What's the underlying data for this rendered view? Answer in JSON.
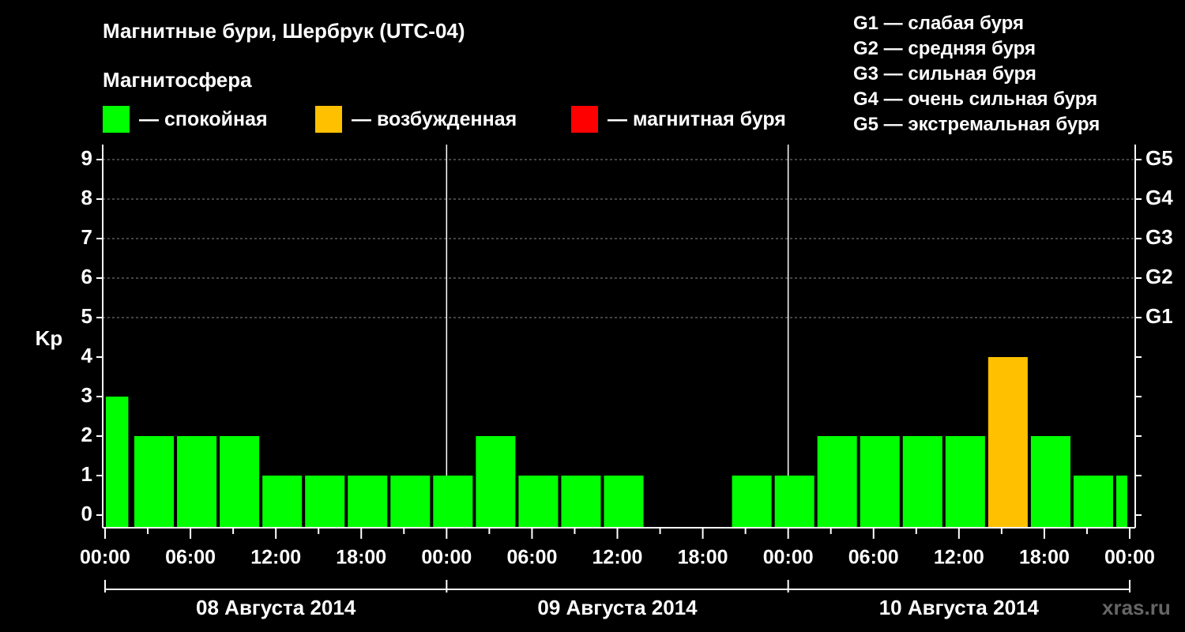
{
  "title": "Магнитные бури, Шербрук (UTC-04)",
  "subtitle": "Магнитосфера",
  "legend": [
    {
      "label": "— спокойная",
      "color": "#00ff00"
    },
    {
      "label": "— возбужденная",
      "color": "#ffc000"
    },
    {
      "label": "— магнитная буря",
      "color": "#ff0000"
    }
  ],
  "g_scale": [
    "G1 — слабая буря",
    "G2 — средняя буря",
    "G3 — сильная буря",
    "G4 — очень сильная буря",
    "G5 — экстремальная буря"
  ],
  "watermark": "xras.ru",
  "chart_data": {
    "type": "bar",
    "ylabel": "Kp",
    "ylim": [
      0,
      9
    ],
    "y_ticks": [
      "0",
      "1",
      "2",
      "3",
      "4",
      "5",
      "6",
      "7",
      "8",
      "9"
    ],
    "right_ticks": [
      {
        "value": 5,
        "label": "G1"
      },
      {
        "value": 6,
        "label": "G2"
      },
      {
        "value": 7,
        "label": "G3"
      },
      {
        "value": 8,
        "label": "G4"
      },
      {
        "value": 9,
        "label": "G5"
      }
    ],
    "x_range_hours": [
      0,
      72
    ],
    "x_tick_labels": [
      "00:00",
      "06:00",
      "12:00",
      "18:00",
      "00:00",
      "06:00",
      "12:00",
      "18:00",
      "00:00",
      "06:00",
      "12:00",
      "18:00",
      "00:00"
    ],
    "days": [
      "08 Августа 2014",
      "09 Августа 2014",
      "10 Августа 2014"
    ],
    "grid": "dashed horizontal at 5–9",
    "colors": {
      "quiet": "#00ff00",
      "active": "#ffc000",
      "storm": "#ff0000"
    },
    "bars": [
      {
        "start": 0,
        "end": 1.8,
        "kp": 3,
        "status": "quiet"
      },
      {
        "start": 2,
        "end": 5,
        "kp": 2,
        "status": "quiet"
      },
      {
        "start": 5,
        "end": 8,
        "kp": 2,
        "status": "quiet"
      },
      {
        "start": 8,
        "end": 11,
        "kp": 2,
        "status": "quiet"
      },
      {
        "start": 11,
        "end": 14,
        "kp": 1,
        "status": "quiet"
      },
      {
        "start": 14,
        "end": 17,
        "kp": 1,
        "status": "quiet"
      },
      {
        "start": 17,
        "end": 20,
        "kp": 1,
        "status": "quiet"
      },
      {
        "start": 20,
        "end": 23,
        "kp": 1,
        "status": "quiet"
      },
      {
        "start": 23,
        "end": 26,
        "kp": 1,
        "status": "quiet"
      },
      {
        "start": 26,
        "end": 29,
        "kp": 2,
        "status": "quiet"
      },
      {
        "start": 29,
        "end": 32,
        "kp": 1,
        "status": "quiet"
      },
      {
        "start": 32,
        "end": 35,
        "kp": 1,
        "status": "quiet"
      },
      {
        "start": 35,
        "end": 38,
        "kp": 1,
        "status": "quiet"
      },
      {
        "start": 38,
        "end": 41,
        "kp": 0,
        "status": "quiet"
      },
      {
        "start": 41,
        "end": 44,
        "kp": 0,
        "status": "quiet"
      },
      {
        "start": 44,
        "end": 47,
        "kp": 1,
        "status": "quiet"
      },
      {
        "start": 47,
        "end": 50,
        "kp": 1,
        "status": "quiet"
      },
      {
        "start": 50,
        "end": 53,
        "kp": 2,
        "status": "quiet"
      },
      {
        "start": 53,
        "end": 56,
        "kp": 2,
        "status": "quiet"
      },
      {
        "start": 56,
        "end": 59,
        "kp": 2,
        "status": "quiet"
      },
      {
        "start": 59,
        "end": 62,
        "kp": 2,
        "status": "quiet"
      },
      {
        "start": 62,
        "end": 65,
        "kp": 4,
        "status": "active"
      },
      {
        "start": 65,
        "end": 68,
        "kp": 2,
        "status": "quiet"
      },
      {
        "start": 68,
        "end": 71,
        "kp": 1,
        "status": "quiet"
      },
      {
        "start": 71,
        "end": 72,
        "kp": 1,
        "status": "quiet"
      }
    ]
  }
}
